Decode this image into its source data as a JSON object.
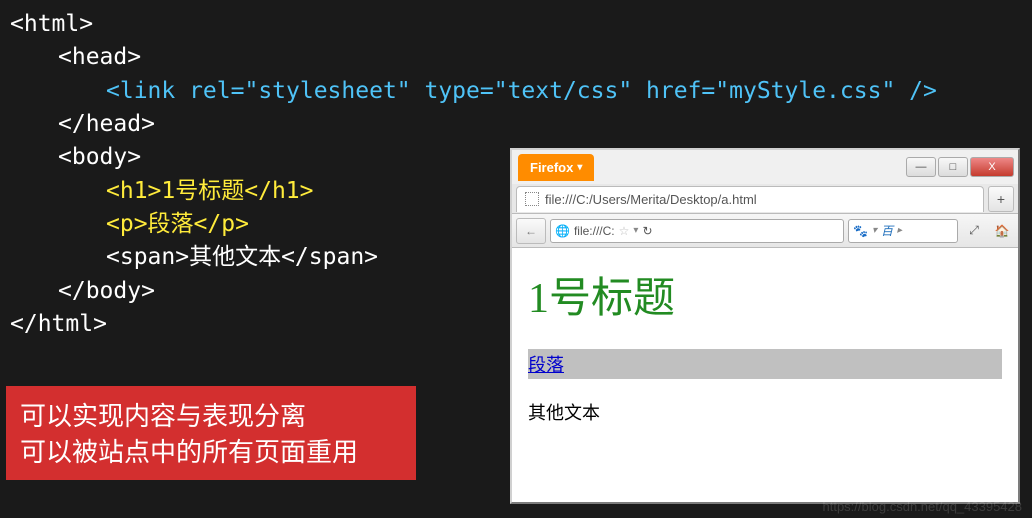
{
  "code": {
    "l1": "<html>",
    "l2": "<head>",
    "l3": "<link rel=\"stylesheet\" type=\"text/css\" href=\"myStyle.css\" />",
    "l4": "</head>",
    "l5": "<body>",
    "l6a": "<h1>",
    "l6b": "1号标题",
    "l6c": "</h1>",
    "l7a": "<p>",
    "l7b": "段落",
    "l7c": "</p>",
    "l8": "<span>其他文本</span>",
    "l9": "</body>",
    "l10": "</html>"
  },
  "note": {
    "line1": "可以实现内容与表现分离",
    "line2": "可以被站点中的所有页面重用"
  },
  "browser": {
    "app_name": "Firefox",
    "tab_title": "file:///C:/Users/Merita/Desktop/a.html",
    "url_short": "file:///C:",
    "search_placeholder": "百",
    "min": "—",
    "max": "□",
    "close": "X",
    "new_tab": "+",
    "back": "←",
    "refresh": "↻",
    "dropdown": "▾",
    "star": "☆",
    "globe": "🌐",
    "paw": "🐾",
    "full": "⤢",
    "home": "🏠"
  },
  "page": {
    "h1": "1号标题",
    "p": "段落",
    "span": "其他文本"
  },
  "watermark": "https://blog.csdn.net/qq_43395428"
}
